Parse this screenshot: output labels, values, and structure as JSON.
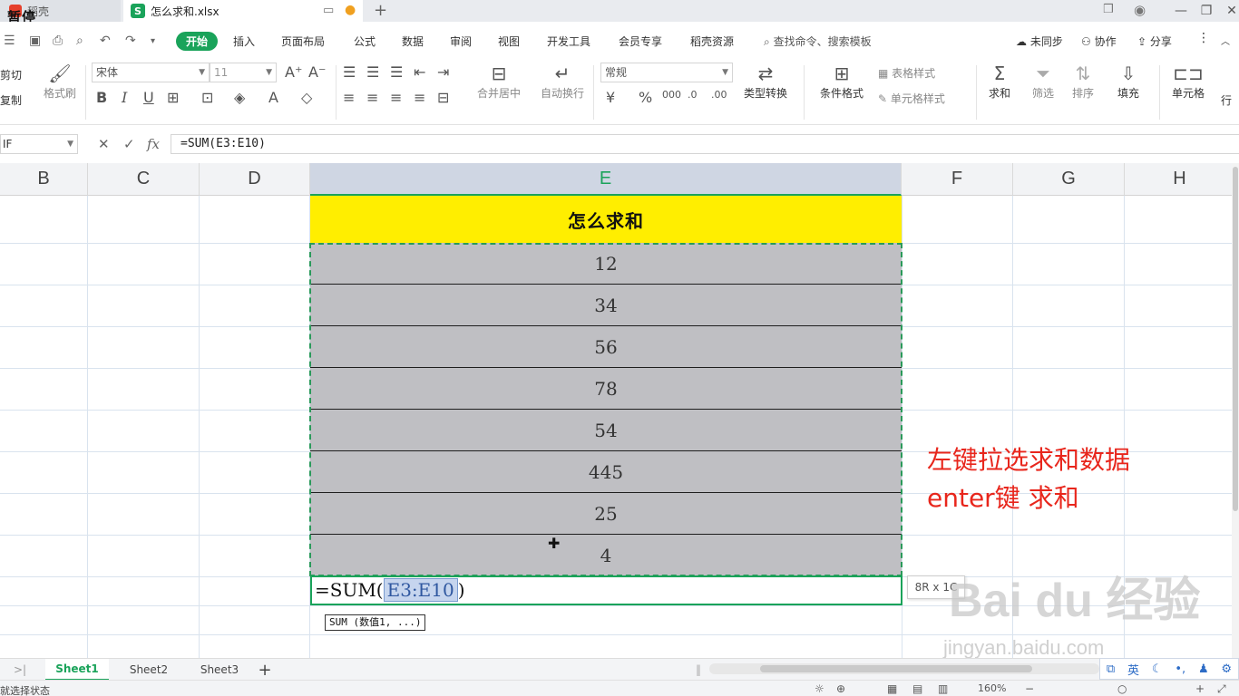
{
  "tabs": {
    "tab1_label": "稻壳",
    "tab2_label": "怎么求和.xlsx",
    "watermark_text": "暂停",
    "add_tab": "+"
  },
  "menu": {
    "start": "开始",
    "items": [
      "插入",
      "页面布局",
      "公式",
      "数据",
      "审阅",
      "视图",
      "开发工具",
      "会员专享",
      "稻壳资源"
    ],
    "search": "查找命令、搜索模板",
    "sync": "未同步",
    "collab": "协作",
    "share": "分享"
  },
  "ribbon": {
    "cut": "剪切",
    "copy": "复制",
    "format_painter": "格式刷",
    "font_name": "宋体",
    "font_size": "11",
    "merge_center": "合并居中",
    "wrap_text": "自动换行",
    "number_format": "常规",
    "type_convert": "类型转换",
    "cond_format": "条件格式",
    "table_style": "表格样式",
    "cell_style": "单元格样式",
    "sum": "求和",
    "filter": "筛选",
    "sort": "排序",
    "fill": "填充",
    "cell": "单元格",
    "row_col": "行"
  },
  "formula_bar": {
    "name_box": "IF",
    "cancel": "✕",
    "confirm": "✓",
    "fx": "fx",
    "formula": "=SUM(E3:E10)"
  },
  "columns": [
    "B",
    "C",
    "D",
    "E",
    "F",
    "G",
    "H"
  ],
  "sheet": {
    "header_cell": "怎么求和",
    "values": [
      "12",
      "34",
      "56",
      "78",
      "54",
      "445",
      "25",
      "4"
    ],
    "edit_prefix": "=SUM(",
    "edit_ref": "E3:E10",
    "edit_suffix": ")",
    "selection_size": "8R x 1C",
    "func_tip": "SUM (数值1, ...)"
  },
  "annotation": {
    "line1": "左键拉选求和数据",
    "line2": "enter键 求和"
  },
  "watermark": {
    "brand": "Bai du 经验",
    "url": "jingyan.baidu.com"
  },
  "sheet_tabs": {
    "sheets": [
      "Sheet1",
      "Sheet2",
      "Sheet3"
    ],
    "add": "+"
  },
  "ime": {
    "lang": "英"
  },
  "status": {
    "text": "就选择状态",
    "zoom": "160%"
  }
}
